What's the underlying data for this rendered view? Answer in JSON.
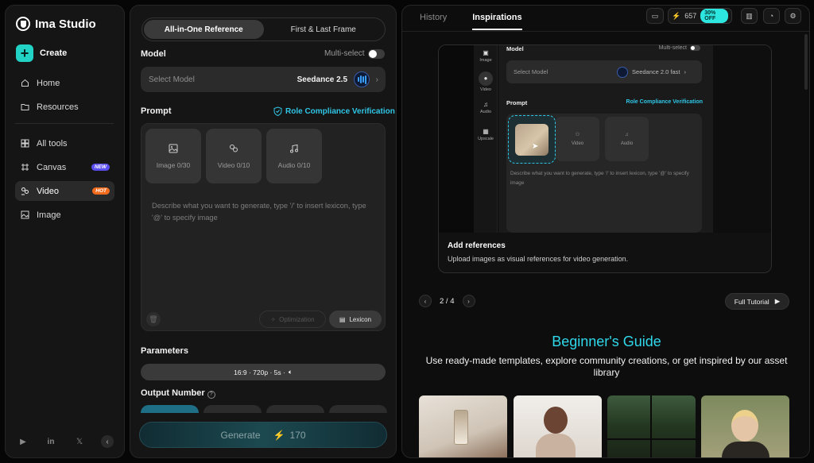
{
  "brand": {
    "name": "Ima Studio"
  },
  "sidebar": {
    "create_label": "Create",
    "items": [
      {
        "label": "Home",
        "icon": "home-icon"
      },
      {
        "label": "Resources",
        "icon": "folder-icon"
      },
      {
        "label": "All tools",
        "icon": "grid-icon"
      },
      {
        "label": "Canvas",
        "icon": "canvas-icon",
        "badge": "NEW"
      },
      {
        "label": "Video",
        "icon": "video-icon",
        "badge": "HOT",
        "active": true
      },
      {
        "label": "Image",
        "icon": "image-icon"
      }
    ]
  },
  "generator": {
    "tabs": [
      "All-in-One Reference",
      "First & Last Frame"
    ],
    "model_label": "Model",
    "multi_select_label": "Multi-select",
    "select_placeholder": "Select Model",
    "selected_model": "Seedance 2.5",
    "prompt_label": "Prompt",
    "role_compliance": "Role Compliance Verification",
    "uploads": [
      {
        "label": "Image 0/30",
        "icon": "image-icon"
      },
      {
        "label": "Video 0/10",
        "icon": "video-ref-icon"
      },
      {
        "label": "Audio 0/10",
        "icon": "music-note-icon"
      }
    ],
    "prompt_placeholder": "Describe what you want to generate, type '/' to insert lexicon, type '@' to specify image",
    "optimization_label": "Optimization",
    "lexicon_label": "Lexicon",
    "parameters_label": "Parameters",
    "parameters_value": "16:9 · 720p · 5s ·",
    "output_number_label": "Output Number",
    "generate_label": "Generate",
    "generate_cost": "170"
  },
  "right": {
    "tabs": [
      "History",
      "Inspirations"
    ],
    "credits": "657",
    "discount": "30% OFF",
    "demo": {
      "side_items": [
        "Image",
        "Video",
        "Audio",
        "Upscale"
      ],
      "model_label": "Model",
      "multi_select": "Multi-select",
      "select_placeholder": "Select Model",
      "selected_model": "Seedance 2.0 fast",
      "prompt_label": "Prompt",
      "role": "Role Compliance Verification",
      "video": "Video",
      "audio": "Audio",
      "placeholder": "Describe what you want to generate, type '/' to insert lexicon, type '@' to specify image"
    },
    "card_title": "Add references",
    "card_subtitle": "Upload images as visual references for video generation.",
    "page_indicator": "2 / 4",
    "full_tutorial": "Full Tutorial",
    "guide_title": "Beginner's Guide",
    "guide_subtitle": "Use ready-made templates, explore community creations, or get inspired by our asset library"
  },
  "colors": {
    "accent": "#22d3c5",
    "cyan_link": "#2fc6e6",
    "new_badge": "#5b4ef0",
    "hot_badge": "#f26b1d"
  }
}
